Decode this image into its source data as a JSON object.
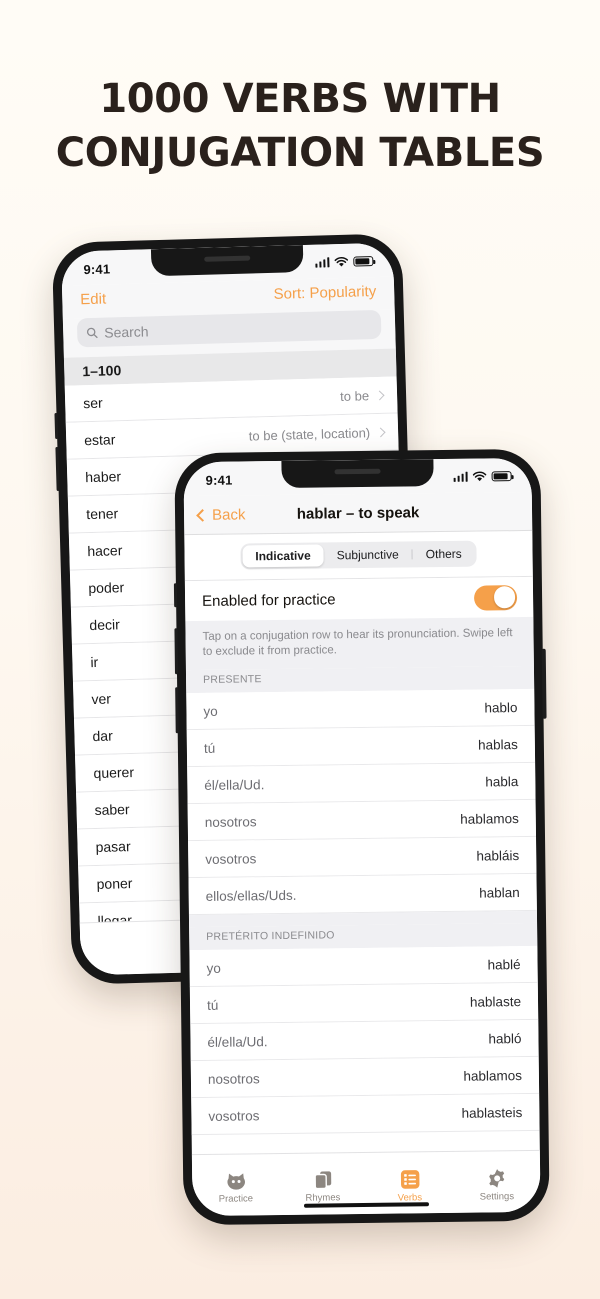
{
  "headline": {
    "line1": "1000 VERBS WITH",
    "line2": "CONJUGATION TABLES"
  },
  "colors": {
    "accent": "#F5A04A",
    "page_background": "#FDF7EF",
    "text": "#2A211C"
  },
  "back_phone": {
    "status_bar": {
      "time": "9:41"
    },
    "nav": {
      "edit_label": "Edit",
      "sort_label": "Sort: Popularity"
    },
    "search": {
      "placeholder": "Search"
    },
    "section_header": "1–100",
    "verbs": [
      {
        "lemma": "ser",
        "gloss": "to be"
      },
      {
        "lemma": "estar",
        "gloss": "to be (state, location)"
      },
      {
        "lemma": "haber",
        "gloss": ""
      },
      {
        "lemma": "tener",
        "gloss": ""
      },
      {
        "lemma": "hacer",
        "gloss": ""
      },
      {
        "lemma": "poder",
        "gloss": ""
      },
      {
        "lemma": "decir",
        "gloss": ""
      },
      {
        "lemma": "ir",
        "gloss": ""
      },
      {
        "lemma": "ver",
        "gloss": ""
      },
      {
        "lemma": "dar",
        "gloss": ""
      },
      {
        "lemma": "querer",
        "gloss": ""
      },
      {
        "lemma": "saber",
        "gloss": ""
      },
      {
        "lemma": "pasar",
        "gloss": ""
      },
      {
        "lemma": "poner",
        "gloss": ""
      },
      {
        "lemma": "llegar",
        "gloss": ""
      }
    ],
    "tabs": [
      {
        "label": "Practice",
        "icon": "cat-icon",
        "active": false
      }
    ]
  },
  "front_phone": {
    "status_bar": {
      "time": "9:41"
    },
    "nav": {
      "back_label": "Back",
      "title": "hablar – to speak"
    },
    "segments": [
      {
        "label": "Indicative",
        "selected": true
      },
      {
        "label": "Subjunctive",
        "selected": false
      },
      {
        "label": "Others",
        "selected": false
      }
    ],
    "practice_switch": {
      "label": "Enabled for practice",
      "on": true
    },
    "hint": "Tap on a conjugation row to hear its pronunciation. Swipe left to exclude it from practice.",
    "tenses": [
      {
        "name": "PRESENTE",
        "rows": [
          {
            "pronoun": "yo",
            "form": "hablo"
          },
          {
            "pronoun": "tú",
            "form": "hablas"
          },
          {
            "pronoun": "él/ella/Ud.",
            "form": "habla"
          },
          {
            "pronoun": "nosotros",
            "form": "hablamos"
          },
          {
            "pronoun": "vosotros",
            "form": "habláis"
          },
          {
            "pronoun": "ellos/ellas/Uds.",
            "form": "hablan"
          }
        ]
      },
      {
        "name": "PRETÉRITO INDEFINIDO",
        "rows": [
          {
            "pronoun": "yo",
            "form": "hablé"
          },
          {
            "pronoun": "tú",
            "form": "hablaste"
          },
          {
            "pronoun": "él/ella/Ud.",
            "form": "habló"
          },
          {
            "pronoun": "nosotros",
            "form": "hablamos"
          },
          {
            "pronoun": "vosotros",
            "form": "hablasteis"
          }
        ]
      }
    ],
    "tabs": [
      {
        "label": "Practice",
        "icon": "cat-icon",
        "active": false
      },
      {
        "label": "Rhymes",
        "icon": "cards-icon",
        "active": false
      },
      {
        "label": "Verbs",
        "icon": "list-icon",
        "active": true
      },
      {
        "label": "Settings",
        "icon": "gear-icon",
        "active": true
      }
    ]
  }
}
